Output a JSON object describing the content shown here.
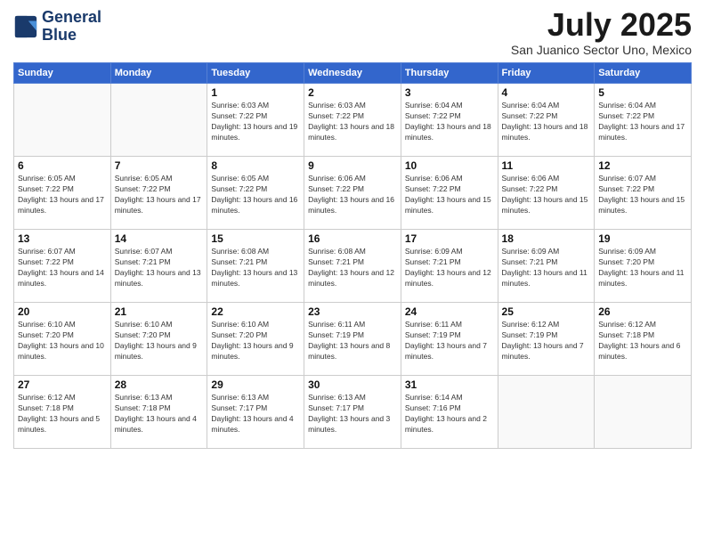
{
  "header": {
    "logo_line1": "General",
    "logo_line2": "Blue",
    "month": "July 2025",
    "location": "San Juanico Sector Uno, Mexico"
  },
  "weekdays": [
    "Sunday",
    "Monday",
    "Tuesday",
    "Wednesday",
    "Thursday",
    "Friday",
    "Saturday"
  ],
  "weeks": [
    [
      {
        "day": "",
        "sunrise": "",
        "sunset": "",
        "daylight": ""
      },
      {
        "day": "",
        "sunrise": "",
        "sunset": "",
        "daylight": ""
      },
      {
        "day": "1",
        "sunrise": "Sunrise: 6:03 AM",
        "sunset": "Sunset: 7:22 PM",
        "daylight": "Daylight: 13 hours and 19 minutes."
      },
      {
        "day": "2",
        "sunrise": "Sunrise: 6:03 AM",
        "sunset": "Sunset: 7:22 PM",
        "daylight": "Daylight: 13 hours and 18 minutes."
      },
      {
        "day": "3",
        "sunrise": "Sunrise: 6:04 AM",
        "sunset": "Sunset: 7:22 PM",
        "daylight": "Daylight: 13 hours and 18 minutes."
      },
      {
        "day": "4",
        "sunrise": "Sunrise: 6:04 AM",
        "sunset": "Sunset: 7:22 PM",
        "daylight": "Daylight: 13 hours and 18 minutes."
      },
      {
        "day": "5",
        "sunrise": "Sunrise: 6:04 AM",
        "sunset": "Sunset: 7:22 PM",
        "daylight": "Daylight: 13 hours and 17 minutes."
      }
    ],
    [
      {
        "day": "6",
        "sunrise": "Sunrise: 6:05 AM",
        "sunset": "Sunset: 7:22 PM",
        "daylight": "Daylight: 13 hours and 17 minutes."
      },
      {
        "day": "7",
        "sunrise": "Sunrise: 6:05 AM",
        "sunset": "Sunset: 7:22 PM",
        "daylight": "Daylight: 13 hours and 17 minutes."
      },
      {
        "day": "8",
        "sunrise": "Sunrise: 6:05 AM",
        "sunset": "Sunset: 7:22 PM",
        "daylight": "Daylight: 13 hours and 16 minutes."
      },
      {
        "day": "9",
        "sunrise": "Sunrise: 6:06 AM",
        "sunset": "Sunset: 7:22 PM",
        "daylight": "Daylight: 13 hours and 16 minutes."
      },
      {
        "day": "10",
        "sunrise": "Sunrise: 6:06 AM",
        "sunset": "Sunset: 7:22 PM",
        "daylight": "Daylight: 13 hours and 15 minutes."
      },
      {
        "day": "11",
        "sunrise": "Sunrise: 6:06 AM",
        "sunset": "Sunset: 7:22 PM",
        "daylight": "Daylight: 13 hours and 15 minutes."
      },
      {
        "day": "12",
        "sunrise": "Sunrise: 6:07 AM",
        "sunset": "Sunset: 7:22 PM",
        "daylight": "Daylight: 13 hours and 15 minutes."
      }
    ],
    [
      {
        "day": "13",
        "sunrise": "Sunrise: 6:07 AM",
        "sunset": "Sunset: 7:22 PM",
        "daylight": "Daylight: 13 hours and 14 minutes."
      },
      {
        "day": "14",
        "sunrise": "Sunrise: 6:07 AM",
        "sunset": "Sunset: 7:21 PM",
        "daylight": "Daylight: 13 hours and 13 minutes."
      },
      {
        "day": "15",
        "sunrise": "Sunrise: 6:08 AM",
        "sunset": "Sunset: 7:21 PM",
        "daylight": "Daylight: 13 hours and 13 minutes."
      },
      {
        "day": "16",
        "sunrise": "Sunrise: 6:08 AM",
        "sunset": "Sunset: 7:21 PM",
        "daylight": "Daylight: 13 hours and 12 minutes."
      },
      {
        "day": "17",
        "sunrise": "Sunrise: 6:09 AM",
        "sunset": "Sunset: 7:21 PM",
        "daylight": "Daylight: 13 hours and 12 minutes."
      },
      {
        "day": "18",
        "sunrise": "Sunrise: 6:09 AM",
        "sunset": "Sunset: 7:21 PM",
        "daylight": "Daylight: 13 hours and 11 minutes."
      },
      {
        "day": "19",
        "sunrise": "Sunrise: 6:09 AM",
        "sunset": "Sunset: 7:20 PM",
        "daylight": "Daylight: 13 hours and 11 minutes."
      }
    ],
    [
      {
        "day": "20",
        "sunrise": "Sunrise: 6:10 AM",
        "sunset": "Sunset: 7:20 PM",
        "daylight": "Daylight: 13 hours and 10 minutes."
      },
      {
        "day": "21",
        "sunrise": "Sunrise: 6:10 AM",
        "sunset": "Sunset: 7:20 PM",
        "daylight": "Daylight: 13 hours and 9 minutes."
      },
      {
        "day": "22",
        "sunrise": "Sunrise: 6:10 AM",
        "sunset": "Sunset: 7:20 PM",
        "daylight": "Daylight: 13 hours and 9 minutes."
      },
      {
        "day": "23",
        "sunrise": "Sunrise: 6:11 AM",
        "sunset": "Sunset: 7:19 PM",
        "daylight": "Daylight: 13 hours and 8 minutes."
      },
      {
        "day": "24",
        "sunrise": "Sunrise: 6:11 AM",
        "sunset": "Sunset: 7:19 PM",
        "daylight": "Daylight: 13 hours and 7 minutes."
      },
      {
        "day": "25",
        "sunrise": "Sunrise: 6:12 AM",
        "sunset": "Sunset: 7:19 PM",
        "daylight": "Daylight: 13 hours and 7 minutes."
      },
      {
        "day": "26",
        "sunrise": "Sunrise: 6:12 AM",
        "sunset": "Sunset: 7:18 PM",
        "daylight": "Daylight: 13 hours and 6 minutes."
      }
    ],
    [
      {
        "day": "27",
        "sunrise": "Sunrise: 6:12 AM",
        "sunset": "Sunset: 7:18 PM",
        "daylight": "Daylight: 13 hours and 5 minutes."
      },
      {
        "day": "28",
        "sunrise": "Sunrise: 6:13 AM",
        "sunset": "Sunset: 7:18 PM",
        "daylight": "Daylight: 13 hours and 4 minutes."
      },
      {
        "day": "29",
        "sunrise": "Sunrise: 6:13 AM",
        "sunset": "Sunset: 7:17 PM",
        "daylight": "Daylight: 13 hours and 4 minutes."
      },
      {
        "day": "30",
        "sunrise": "Sunrise: 6:13 AM",
        "sunset": "Sunset: 7:17 PM",
        "daylight": "Daylight: 13 hours and 3 minutes."
      },
      {
        "day": "31",
        "sunrise": "Sunrise: 6:14 AM",
        "sunset": "Sunset: 7:16 PM",
        "daylight": "Daylight: 13 hours and 2 minutes."
      },
      {
        "day": "",
        "sunrise": "",
        "sunset": "",
        "daylight": ""
      },
      {
        "day": "",
        "sunrise": "",
        "sunset": "",
        "daylight": ""
      }
    ]
  ]
}
